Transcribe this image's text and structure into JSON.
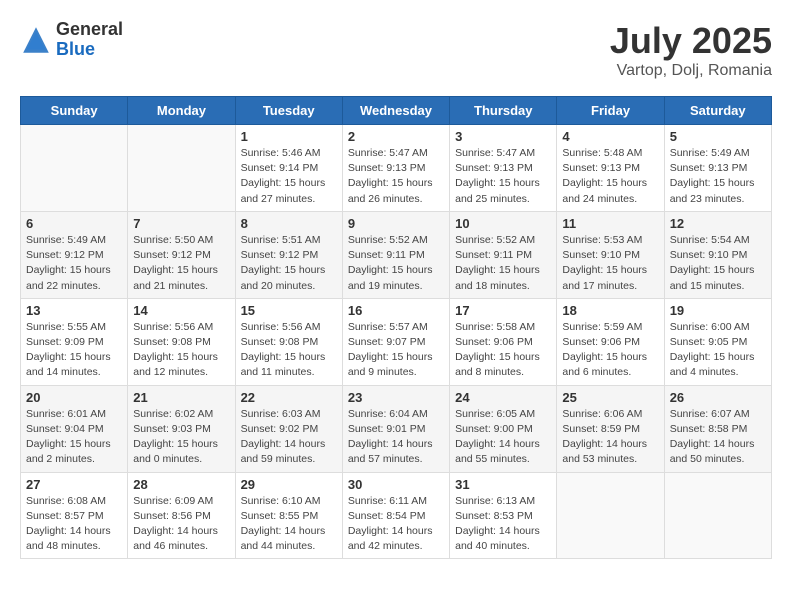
{
  "logo": {
    "general": "General",
    "blue": "Blue"
  },
  "title": "July 2025",
  "location": "Vartop, Dolj, Romania",
  "days_of_week": [
    "Sunday",
    "Monday",
    "Tuesday",
    "Wednesday",
    "Thursday",
    "Friday",
    "Saturday"
  ],
  "weeks": [
    [
      {
        "day": "",
        "info": ""
      },
      {
        "day": "",
        "info": ""
      },
      {
        "day": "1",
        "info": "Sunrise: 5:46 AM\nSunset: 9:14 PM\nDaylight: 15 hours and 27 minutes."
      },
      {
        "day": "2",
        "info": "Sunrise: 5:47 AM\nSunset: 9:13 PM\nDaylight: 15 hours and 26 minutes."
      },
      {
        "day": "3",
        "info": "Sunrise: 5:47 AM\nSunset: 9:13 PM\nDaylight: 15 hours and 25 minutes."
      },
      {
        "day": "4",
        "info": "Sunrise: 5:48 AM\nSunset: 9:13 PM\nDaylight: 15 hours and 24 minutes."
      },
      {
        "day": "5",
        "info": "Sunrise: 5:49 AM\nSunset: 9:13 PM\nDaylight: 15 hours and 23 minutes."
      }
    ],
    [
      {
        "day": "6",
        "info": "Sunrise: 5:49 AM\nSunset: 9:12 PM\nDaylight: 15 hours and 22 minutes."
      },
      {
        "day": "7",
        "info": "Sunrise: 5:50 AM\nSunset: 9:12 PM\nDaylight: 15 hours and 21 minutes."
      },
      {
        "day": "8",
        "info": "Sunrise: 5:51 AM\nSunset: 9:12 PM\nDaylight: 15 hours and 20 minutes."
      },
      {
        "day": "9",
        "info": "Sunrise: 5:52 AM\nSunset: 9:11 PM\nDaylight: 15 hours and 19 minutes."
      },
      {
        "day": "10",
        "info": "Sunrise: 5:52 AM\nSunset: 9:11 PM\nDaylight: 15 hours and 18 minutes."
      },
      {
        "day": "11",
        "info": "Sunrise: 5:53 AM\nSunset: 9:10 PM\nDaylight: 15 hours and 17 minutes."
      },
      {
        "day": "12",
        "info": "Sunrise: 5:54 AM\nSunset: 9:10 PM\nDaylight: 15 hours and 15 minutes."
      }
    ],
    [
      {
        "day": "13",
        "info": "Sunrise: 5:55 AM\nSunset: 9:09 PM\nDaylight: 15 hours and 14 minutes."
      },
      {
        "day": "14",
        "info": "Sunrise: 5:56 AM\nSunset: 9:08 PM\nDaylight: 15 hours and 12 minutes."
      },
      {
        "day": "15",
        "info": "Sunrise: 5:56 AM\nSunset: 9:08 PM\nDaylight: 15 hours and 11 minutes."
      },
      {
        "day": "16",
        "info": "Sunrise: 5:57 AM\nSunset: 9:07 PM\nDaylight: 15 hours and 9 minutes."
      },
      {
        "day": "17",
        "info": "Sunrise: 5:58 AM\nSunset: 9:06 PM\nDaylight: 15 hours and 8 minutes."
      },
      {
        "day": "18",
        "info": "Sunrise: 5:59 AM\nSunset: 9:06 PM\nDaylight: 15 hours and 6 minutes."
      },
      {
        "day": "19",
        "info": "Sunrise: 6:00 AM\nSunset: 9:05 PM\nDaylight: 15 hours and 4 minutes."
      }
    ],
    [
      {
        "day": "20",
        "info": "Sunrise: 6:01 AM\nSunset: 9:04 PM\nDaylight: 15 hours and 2 minutes."
      },
      {
        "day": "21",
        "info": "Sunrise: 6:02 AM\nSunset: 9:03 PM\nDaylight: 15 hours and 0 minutes."
      },
      {
        "day": "22",
        "info": "Sunrise: 6:03 AM\nSunset: 9:02 PM\nDaylight: 14 hours and 59 minutes."
      },
      {
        "day": "23",
        "info": "Sunrise: 6:04 AM\nSunset: 9:01 PM\nDaylight: 14 hours and 57 minutes."
      },
      {
        "day": "24",
        "info": "Sunrise: 6:05 AM\nSunset: 9:00 PM\nDaylight: 14 hours and 55 minutes."
      },
      {
        "day": "25",
        "info": "Sunrise: 6:06 AM\nSunset: 8:59 PM\nDaylight: 14 hours and 53 minutes."
      },
      {
        "day": "26",
        "info": "Sunrise: 6:07 AM\nSunset: 8:58 PM\nDaylight: 14 hours and 50 minutes."
      }
    ],
    [
      {
        "day": "27",
        "info": "Sunrise: 6:08 AM\nSunset: 8:57 PM\nDaylight: 14 hours and 48 minutes."
      },
      {
        "day": "28",
        "info": "Sunrise: 6:09 AM\nSunset: 8:56 PM\nDaylight: 14 hours and 46 minutes."
      },
      {
        "day": "29",
        "info": "Sunrise: 6:10 AM\nSunset: 8:55 PM\nDaylight: 14 hours and 44 minutes."
      },
      {
        "day": "30",
        "info": "Sunrise: 6:11 AM\nSunset: 8:54 PM\nDaylight: 14 hours and 42 minutes."
      },
      {
        "day": "31",
        "info": "Sunrise: 6:13 AM\nSunset: 8:53 PM\nDaylight: 14 hours and 40 minutes."
      },
      {
        "day": "",
        "info": ""
      },
      {
        "day": "",
        "info": ""
      }
    ]
  ]
}
